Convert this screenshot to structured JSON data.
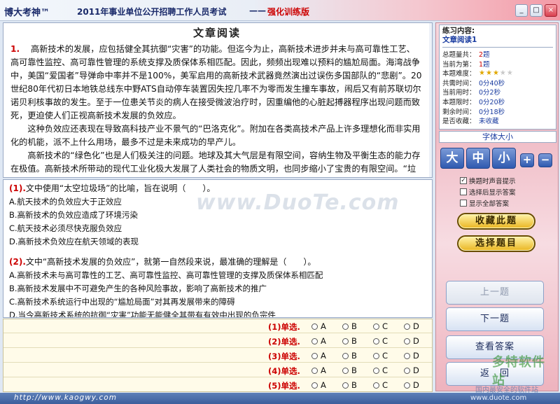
{
  "titlebar": {
    "logo": "博大考神™",
    "exam": "2011年事业单位公开招聘工作人员考试",
    "separator": "——",
    "mode": "强化训练版",
    "min": "_",
    "max": "□",
    "close": "×"
  },
  "passage": {
    "title": "文章阅读",
    "number": "1.",
    "paragraphs": [
      "高新技术的发展，应包括健全其抗御“灾害”的功能。但迄今为止，高新技术进步并未与高可靠性工艺、高可靠性监控、高可靠性管理的系统支撑及质保体系相匹配。因此，频频出现难以预料的尴尬局面。海湾战争中，美国“爱国者”导弹命中率并不是100%，美军启用的高新技术武器竟然演出过误伤多国部队的“悲剧”。20世纪80年代初日本地铁总线东中野ATS自动停车装置因失控几率不为零而发生撞车事故，闹后又有前苏联切尔诺贝利核事故的发生。至于一位患关节炎的病人在接受微波治疗时，因重编他的心脏起搏器程序出现问题而致死，更迫使人们正视高新技术发展的负效应。",
      "这种负效应还表现在导致高科技产业不景气的“巴洛克化”。附加在各类高技术产品上许多理想化而非实用化的机能，派不上什么用场，最多不过是未来成功的早产儿。",
      "高新技术的“绿色化”也是人们极关注的问题。地球及其大气层是有限空间，容纳生物及平衡生态的能力存在极值。高新技术所带动的现代工业化极大发展了人类社会的物质文明，也同步缩小了宝贵的有限空间。“垃圾”事件不是想象中的整顿了，减少人工一“以及这种去了线路为地的一“为么技术”报攒人类向"
    ]
  },
  "questions": [
    {
      "num": "(1).",
      "stem": "文中使用“太空垃圾场”的比喻，旨在说明（　　）。",
      "options": [
        "A.航天技术的负效应大于正效应",
        "B.高新技术的负效应造成了环境污染",
        "C.航天技术必须尽快克服负效应",
        "D.高新技术负效应在航天领域的表现"
      ]
    },
    {
      "num": "(2).",
      "stem": "文中“高新技术发展的负效应”，就第一自然段来说，最准确的理解是（　　）。",
      "options": [
        "A.高新技术未与高可靠性的工艺、高可靠性监控、高可靠性管理的支撑及质保体系相匹配",
        "B.高新技术发展中不可避免产生的各种风险事故，影响了高新技术的推广",
        "C.高新技术系统运行中出现的“尴尬局面”对其再发展带来的障碍",
        "D.当今高新技术系统的抗御“灾害”功能无能健全其带有有效中出现的负宗件"
      ]
    }
  ],
  "watermark": "www.DuoTe.com",
  "answers": {
    "rows": [
      {
        "label": "(1)单选."
      },
      {
        "label": "(2)单选."
      },
      {
        "label": "(3)单选."
      },
      {
        "label": "(4)单选."
      },
      {
        "label": "(5)单选."
      }
    ],
    "choices": [
      "A",
      "B",
      "C",
      "D"
    ]
  },
  "info": {
    "title": "练习内容:",
    "subject": "文章阅读1",
    "rows": [
      {
        "k": "总题量共：",
        "v": "2题",
        "red": "2"
      },
      {
        "k": "当前为第：",
        "v": "1题",
        "red": "1"
      },
      {
        "k": "本题难度：",
        "v": ""
      },
      {
        "k": "共需时间：",
        "v": "0分40秒"
      },
      {
        "k": "当前用时：",
        "v": "0分2秒"
      },
      {
        "k": "本题限时：",
        "v": "0分20秒"
      },
      {
        "k": "剩余时间：",
        "v": "0分18秒"
      },
      {
        "k": "是否收藏：",
        "v": "未收藏"
      }
    ],
    "difficulty": 3
  },
  "fontsize": {
    "label": "字体大小",
    "large": "大",
    "medium": "中",
    "small": "小",
    "plus": "+",
    "minus": "−"
  },
  "checks": [
    {
      "label": "换题时声音提示",
      "checked": true
    },
    {
      "label": "选择后显示答案",
      "checked": false
    },
    {
      "label": "显示全部答案",
      "checked": false
    }
  ],
  "buttons": {
    "favorite": "收藏此题",
    "choose": "选择题目",
    "prev": "上一题",
    "next": "下一题",
    "answer": "查看答案",
    "back": "返　回"
  },
  "corner": {
    "logo": "多特软件站",
    "text": "国内最安全的软件站"
  },
  "status": {
    "url": "http://www.kaogwy.com",
    "brand": "www.duote.com"
  }
}
